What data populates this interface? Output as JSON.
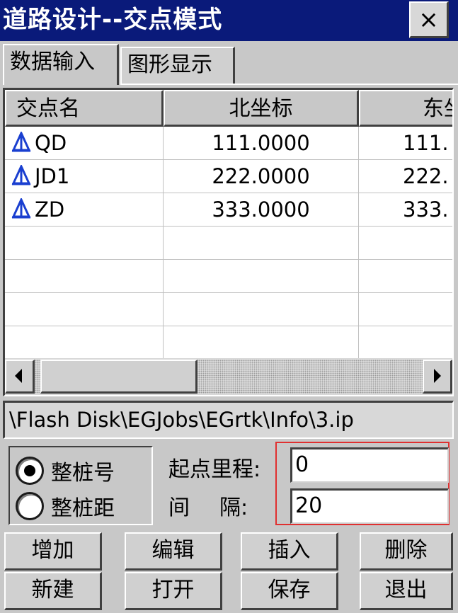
{
  "window": {
    "title": "道路设计--交点模式",
    "close_label": "×"
  },
  "tabs": [
    {
      "label": "数据输入",
      "active": true
    },
    {
      "label": "图形显示",
      "active": false
    }
  ],
  "table": {
    "columns": [
      "交点名",
      "北坐标",
      "东坐标"
    ],
    "rows": [
      {
        "icon": "survey-point-icon",
        "name": "QD",
        "north": "111.0000",
        "east": "111."
      },
      {
        "icon": "survey-point-icon",
        "name": "JD1",
        "north": "222.0000",
        "east": "222."
      },
      {
        "icon": "survey-point-icon",
        "name": "ZD",
        "north": "333.0000",
        "east": "333."
      }
    ],
    "empty_rows": 4,
    "scroll_position": 0
  },
  "file_path": "\\Flash Disk\\EGJobs\\EGrtk\\Info\\3.ip",
  "mode": {
    "options": [
      {
        "label": "整桩号",
        "selected": true
      },
      {
        "label": "整桩距",
        "selected": false
      }
    ]
  },
  "fields": {
    "start_mileage_label": "起点里程:",
    "start_mileage_value": "0",
    "interval_label_1": "间",
    "interval_label_2": "隔:",
    "interval_value": "20"
  },
  "buttons": {
    "add": "增加",
    "edit": "编辑",
    "insert": "插入",
    "delete": "删除",
    "new": "新建",
    "open": "打开",
    "save": "保存",
    "exit": "退出"
  },
  "colors": {
    "titlebar": "#0a1a7a",
    "face": "#c8c8c8",
    "icon_blue": "#1a3fd0",
    "highlight_frame": "#e03030"
  }
}
